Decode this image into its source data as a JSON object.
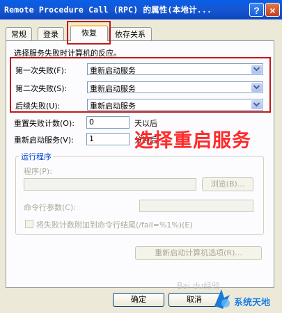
{
  "window": {
    "title": "Remote Procedure Call (RPC) 的属性(本地计...",
    "help_button": "?",
    "close_button": "×"
  },
  "tabs": [
    {
      "label": "常规",
      "active": false
    },
    {
      "label": "登录",
      "active": false
    },
    {
      "label": "恢复",
      "active": true
    },
    {
      "label": "依存关系",
      "active": false
    }
  ],
  "recovery": {
    "instruction": "选择服务失败时计算机的反应。",
    "first_failure": {
      "label": "第一次失败(F):",
      "value": "重新启动服务"
    },
    "second_failure": {
      "label": "第二次失败(S):",
      "value": "重新启动服务"
    },
    "subsequent_failures": {
      "label": "后续失败(U):",
      "value": "重新启动服务"
    },
    "reset_fail_count": {
      "label": "重置失败计数(O):",
      "value": "0",
      "unit": "天以后"
    },
    "restart_service": {
      "label": "重新启动服务(V):",
      "value": "1",
      "unit": "分钟后"
    }
  },
  "run_program": {
    "group_title": "运行程序",
    "program_label": "程序(P):",
    "program_value": "",
    "browse_button": "浏览(B)...",
    "cmd_params_label": "命令行参数(C):",
    "cmd_params_value": "",
    "append_checkbox_label": "将失败计数附加到命令行结尾(/fail=%1%)(E)"
  },
  "restart_options_button": "重新启动计算机选项(R)...",
  "footer": {
    "ok_button": "确定",
    "cancel_button": "取消"
  },
  "annotation": "选择重启服务",
  "watermarks": {
    "site": "系统天地",
    "baidu": "Bai du经验"
  },
  "colors": {
    "annotation": "#ff2a2a",
    "highlight_box": "#c01818",
    "titlebar": "#0a5fe8"
  }
}
